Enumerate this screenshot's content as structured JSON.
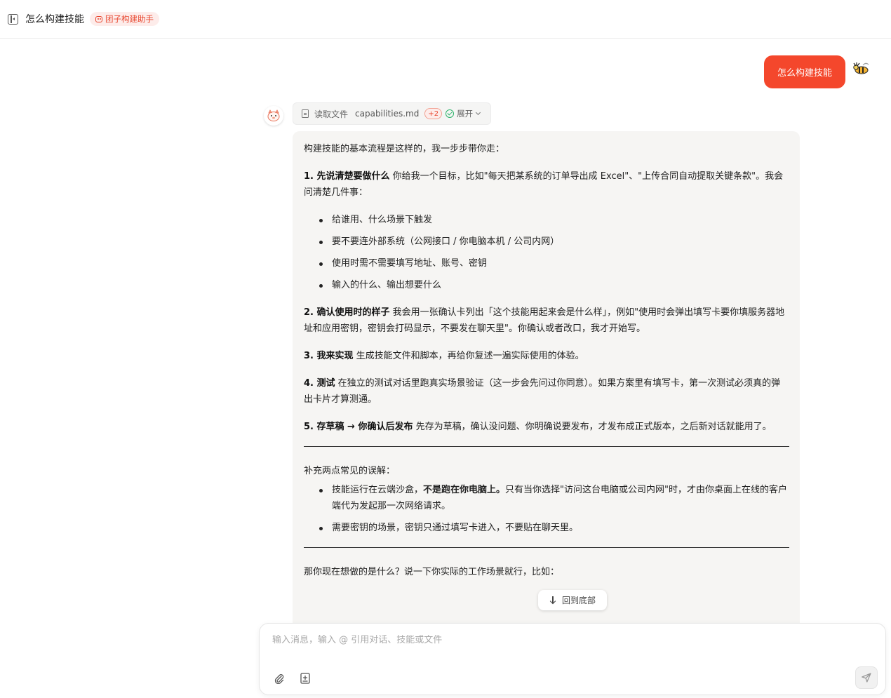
{
  "header": {
    "title": "怎么构建技能",
    "agent_label": "团子构建助手"
  },
  "user_message": {
    "text": "怎么构建技能"
  },
  "tool_call": {
    "action": "读取文件",
    "file": "capabilities.md",
    "extra_count": "+2",
    "expand_label": "展开"
  },
  "answer": {
    "intro": "构建技能的基本流程是这样的，我一步步带你走：",
    "step1_title": "1. 先说清楚要做什么",
    "step1_text": " 你给我一个目标，比如\"每天把某系统的订单导出成 Excel\"、\"上传合同自动提取关键条款\"。我会问清楚几件事：",
    "step1_items": [
      "给谁用、什么场景下触发",
      "要不要连外部系统（公网接口 / 你电脑本机 / 公司内网）",
      "使用时需不需要填写地址、账号、密钥",
      "输入的什么、输出想要什么"
    ],
    "step2_title": "2. 确认使用时的样子",
    "step2_text": " 我会用一张确认卡列出「这个技能用起来会是什么样」，例如\"使用时会弹出填写卡要你填服务器地址和应用密钥，密钥会打码显示，不要发在聊天里\"。你确认或者改口，我才开始写。",
    "step3_title": "3. 我来实现",
    "step3_text": " 生成技能文件和脚本，再给你复述一遍实际使用的体验。",
    "step4_title": "4. 测试",
    "step4_text": " 在独立的测试对话里跑真实场景验证（这一步会先问过你同意）。如果方案里有填写卡，第一次测试必须真的弹出卡片才算测通。",
    "step5_title": "5. 存草稿 → 你确认后发布",
    "step5_text": " 先存为草稿，确认没问题、你明确说要发布，才发布成正式版本，之后新对话就能用了。",
    "supplement_intro": "补充两点常见的误解：",
    "supp_item1_a": "技能运行在云端沙盒，",
    "supp_item1_b": "不是跑在你电脑上。",
    "supp_item1_c": "只有当你选择\"访问这台电脑或公司内网\"时，才由你桌面上在线的客户端代为发起那一次网络请求。",
    "supp_item2": "需要密钥的场景，密钥只通过填写卡进入，不要贴在聊天里。",
    "closing": "那你现在想做的是什么？说一下你实际的工作场景就行，比如："
  },
  "scroll_button": {
    "label": "回到底部"
  },
  "composer": {
    "placeholder": "输入消息，输入 @ 引用对话、技能或文件",
    "value": ""
  },
  "colors": {
    "accent": "#f4472c",
    "chip_bg": "#fdecea",
    "answer_bg": "#f6f5f3",
    "check": "#2db36b"
  },
  "icons": {
    "sidebar": "sidebar-toggle-icon",
    "agent": "robot-icon",
    "file": "file-icon",
    "check": "check-circle-icon",
    "chevron": "chevron-down-icon",
    "down": "arrow-down-icon",
    "attach": "paperclip-icon",
    "skill": "add-skill-icon",
    "send": "send-icon"
  }
}
